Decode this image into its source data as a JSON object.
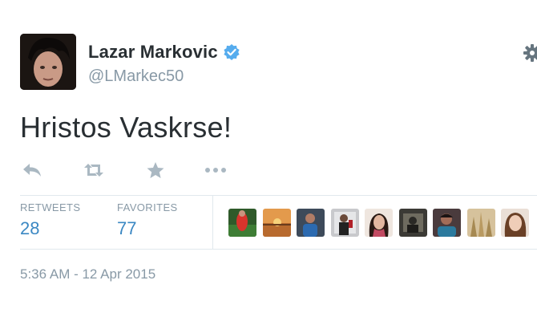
{
  "tweet": {
    "author_name": "Lazar Markovic",
    "author_handle": "@LMarkec50",
    "text": "Hristos Vaskrse!",
    "timestamp": "5:36 AM - 12 Apr 2015"
  },
  "stats": {
    "retweets_label": "RETWEETS",
    "retweets_count": "28",
    "favorites_label": "FAVORITES",
    "favorites_count": "77"
  },
  "icons": {
    "verified": "verified-badge-icon",
    "settings": "gear-icon",
    "reply": "reply-icon",
    "retweet": "retweet-icon",
    "favorite": "star-icon",
    "more": "more-icon"
  },
  "colors": {
    "text": "#292f33",
    "muted": "#8899a6",
    "link": "#3b88c3",
    "verified": "#55acee"
  }
}
